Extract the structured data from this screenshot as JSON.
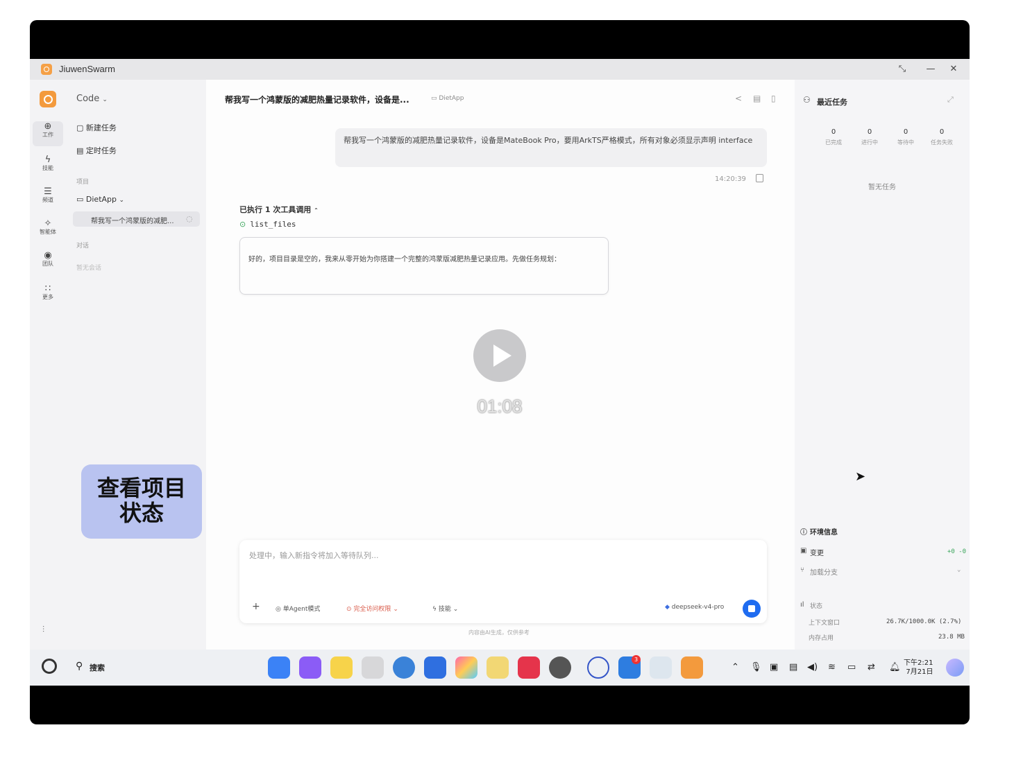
{
  "window": {
    "title": "JiuwenSwarm"
  },
  "rail": {
    "items": [
      {
        "label": "工作",
        "icon": "work-icon"
      },
      {
        "label": "技能",
        "icon": "skill-icon"
      },
      {
        "label": "频道",
        "icon": "channel-icon"
      },
      {
        "label": "智能体",
        "icon": "agent-icon"
      },
      {
        "label": "团队",
        "icon": "team-icon"
      },
      {
        "label": "更多",
        "icon": "more-icon"
      }
    ]
  },
  "sidebar": {
    "mode": "Code",
    "new_task": "新建任务",
    "scheduled_task": "定时任务",
    "projects_section": "项目",
    "project_name": "DietApp",
    "active_session": "帮我写一个鸿蒙版的减肥...",
    "conversations_section": "对话",
    "no_conversations": "暂无会话"
  },
  "overlay": {
    "line1": "查看项目",
    "line2": "状态"
  },
  "chat": {
    "title": "帮我写一个鸿蒙版的减肥热量记录软件，设备是...",
    "project_tag": "DietApp",
    "user_message": "帮我写一个鸿蒙版的减肥热量记录软件，设备是MateBook Pro，要用ArkTS严格模式，所有对象必须显示声明 interface",
    "timestamp": "14:20:39",
    "tool_header": "已执行 1 次工具调用",
    "tool_call": "list_files",
    "assistant_message": "好的，项目目录是空的，我来从零开始为你搭建一个完整的鸿蒙版减肥热量记录应用。先做任务规划："
  },
  "video": {
    "time": "01:08"
  },
  "composer": {
    "placeholder": "处理中，输入新指令将加入等待队列...",
    "mode": "单Agent模式",
    "permission": "完全访问权限",
    "skills": "技能",
    "model": "deepseek-v4-pro",
    "disclaimer": "内容由AI生成，仅供参考"
  },
  "right_panel": {
    "title": "最近任务",
    "stats": [
      {
        "value": "0",
        "label": "已完成"
      },
      {
        "value": "0",
        "label": "进行中"
      },
      {
        "value": "0",
        "label": "等待中"
      },
      {
        "value": "0",
        "label": "任务失败"
      }
    ],
    "empty": "暂无任务",
    "env_info": "环境信息",
    "changes": "变更",
    "changes_value": "+0 -0",
    "branch": "加载分支",
    "status": "状态",
    "context_label": "上下文窗口",
    "context_value": "26.7K/1000.0K (2.7%)",
    "memory_label": "内存占用",
    "memory_value": "23.8 MB"
  },
  "taskbar": {
    "search": "搜索",
    "time": "下午2:21",
    "date": "7月21日",
    "notification_count": "3"
  },
  "colors": {
    "accent": "#1f6cf0",
    "brand": "#f39a3d",
    "overlay": "#b9c3f0"
  }
}
